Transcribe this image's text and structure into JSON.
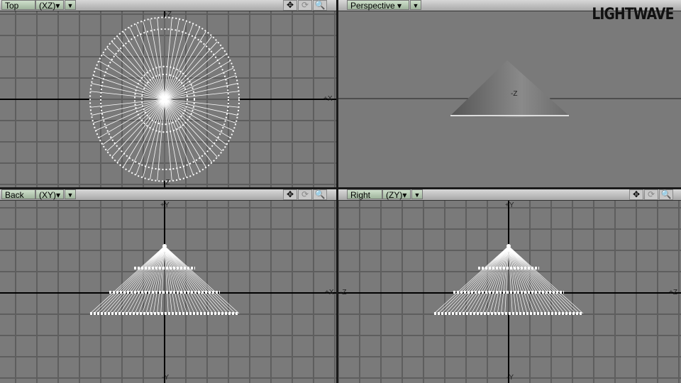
{
  "logo": "LIGHTWAVE",
  "viewports": [
    {
      "name": "Top",
      "mode": "(XZ)",
      "axes": {
        "up": "+Z",
        "right": "+X",
        "down": "-Z"
      }
    },
    {
      "name": "Perspective",
      "mode": "",
      "axes": {
        "center": "-Z"
      }
    },
    {
      "name": "Back",
      "mode": "(XY)",
      "axes": {
        "up": "+Y",
        "right": "+X",
        "down": "-Y"
      }
    },
    {
      "name": "Right",
      "mode": "(ZY)",
      "axes": {
        "up": "+Y",
        "left": "-Z",
        "right": "+Z",
        "down": "-Y"
      }
    }
  ],
  "icons": [
    "move-icon",
    "rotate-icon",
    "zoom-icon"
  ],
  "colors": {
    "viewport": "#7a7a7a",
    "wire": "#ffffff",
    "grid": "#5e5e5e"
  }
}
